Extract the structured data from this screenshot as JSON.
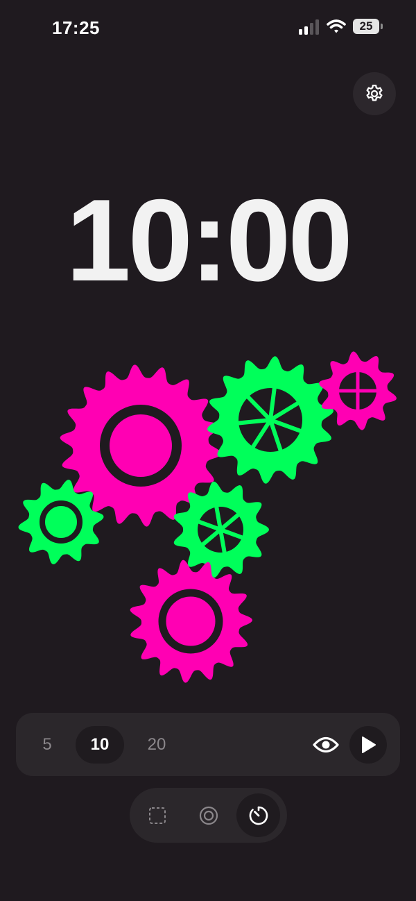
{
  "status_bar": {
    "time": "17:25",
    "battery_level": "25"
  },
  "timer": {
    "display": "10:00"
  },
  "durations": {
    "options": [
      "5",
      "10",
      "20"
    ],
    "selected": "10"
  },
  "colors": {
    "background": "#1f1a1f",
    "gear_magenta": "#ff00b3",
    "gear_green": "#00ff5a",
    "panel": "#2b272b"
  },
  "icons": {
    "settings": "gear-icon",
    "visibility": "eye-icon",
    "play": "play-icon",
    "mode_square": "dashed-square-icon",
    "mode_circle": "concentric-circle-icon",
    "mode_timer": "timer-icon"
  },
  "modes": {
    "active": "timer"
  }
}
